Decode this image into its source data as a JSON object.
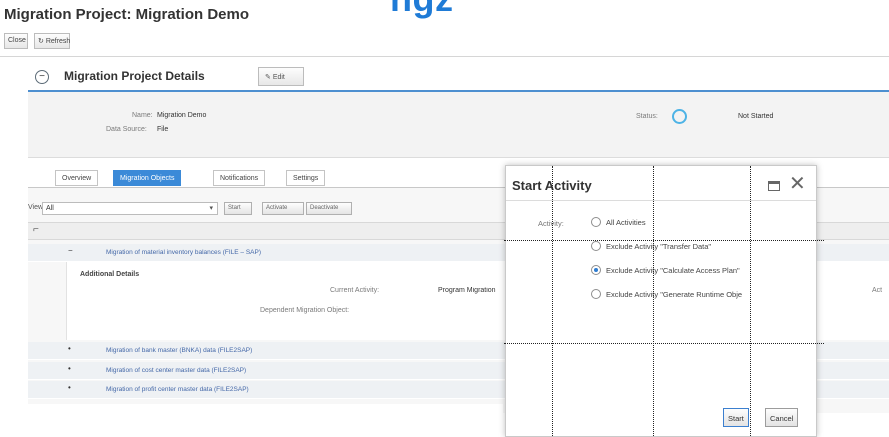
{
  "banner_fragment": "ngz",
  "page": {
    "title": "Migration Project: Migration Demo"
  },
  "toolbar": {
    "close_label": "Close",
    "refresh_label": "Refresh"
  },
  "section": {
    "title": "Migration Project Details",
    "edit_label": "Edit"
  },
  "details": {
    "name_label": "Name:",
    "name_value": "Migration Demo",
    "data_source_label": "Data Source:",
    "data_source_value": "File",
    "status_label": "Status:",
    "status_value": "Not Started",
    "status_color": "#4db3e6"
  },
  "tabs": [
    {
      "label": "Overview"
    },
    {
      "label": "Migration Objects"
    },
    {
      "label": "Notifications"
    },
    {
      "label": "Settings"
    }
  ],
  "table_toolbar": {
    "view_label": "View:",
    "view_value": "All",
    "start_label": "Start",
    "activate_label": "Activate",
    "deactivate_label": "Deactivate"
  },
  "rows": [
    {
      "toggle": "−",
      "label": "Migration of material inventory balances (FILE – SAP)"
    },
    {
      "toggle": "•",
      "label": "Migration of bank master (BNKA) data (FILE2SAP)"
    },
    {
      "toggle": "•",
      "label": "Migration of cost center master data (FILE2SAP)"
    },
    {
      "toggle": "•",
      "label": "Migration of profit center master data (FILE2SAP)"
    }
  ],
  "additional": {
    "title": "Additional Details",
    "current_activity_label": "Current Activity:",
    "current_activity_value": "Program Migration",
    "dependent_label": "Dependent Migration Object:",
    "cut_text": "Act"
  },
  "dialog": {
    "title": "Start Activity",
    "activity_label": "Activity:",
    "options": [
      {
        "label": "All Activities",
        "selected": false
      },
      {
        "label": "Exclude Activity \"Transfer Data\"",
        "selected": false
      },
      {
        "label": "Exclude Activity \"Calculate Access Plan\"",
        "selected": true
      },
      {
        "label": "Exclude Activity \"Generate Runtime Obje",
        "selected": false
      }
    ],
    "start_label": "Start",
    "cancel_label": "Cancel"
  },
  "colors": {
    "accent": "#3b8ad8",
    "link": "#4468a8",
    "banner": "#1f7bd6"
  },
  "icons": {
    "collapse": "collapse-circle-icon",
    "edit": "pencil-icon",
    "refresh": "refresh-icon",
    "settings": "table-settings-icon",
    "maximize": "maximize-icon",
    "close": "close-icon"
  }
}
